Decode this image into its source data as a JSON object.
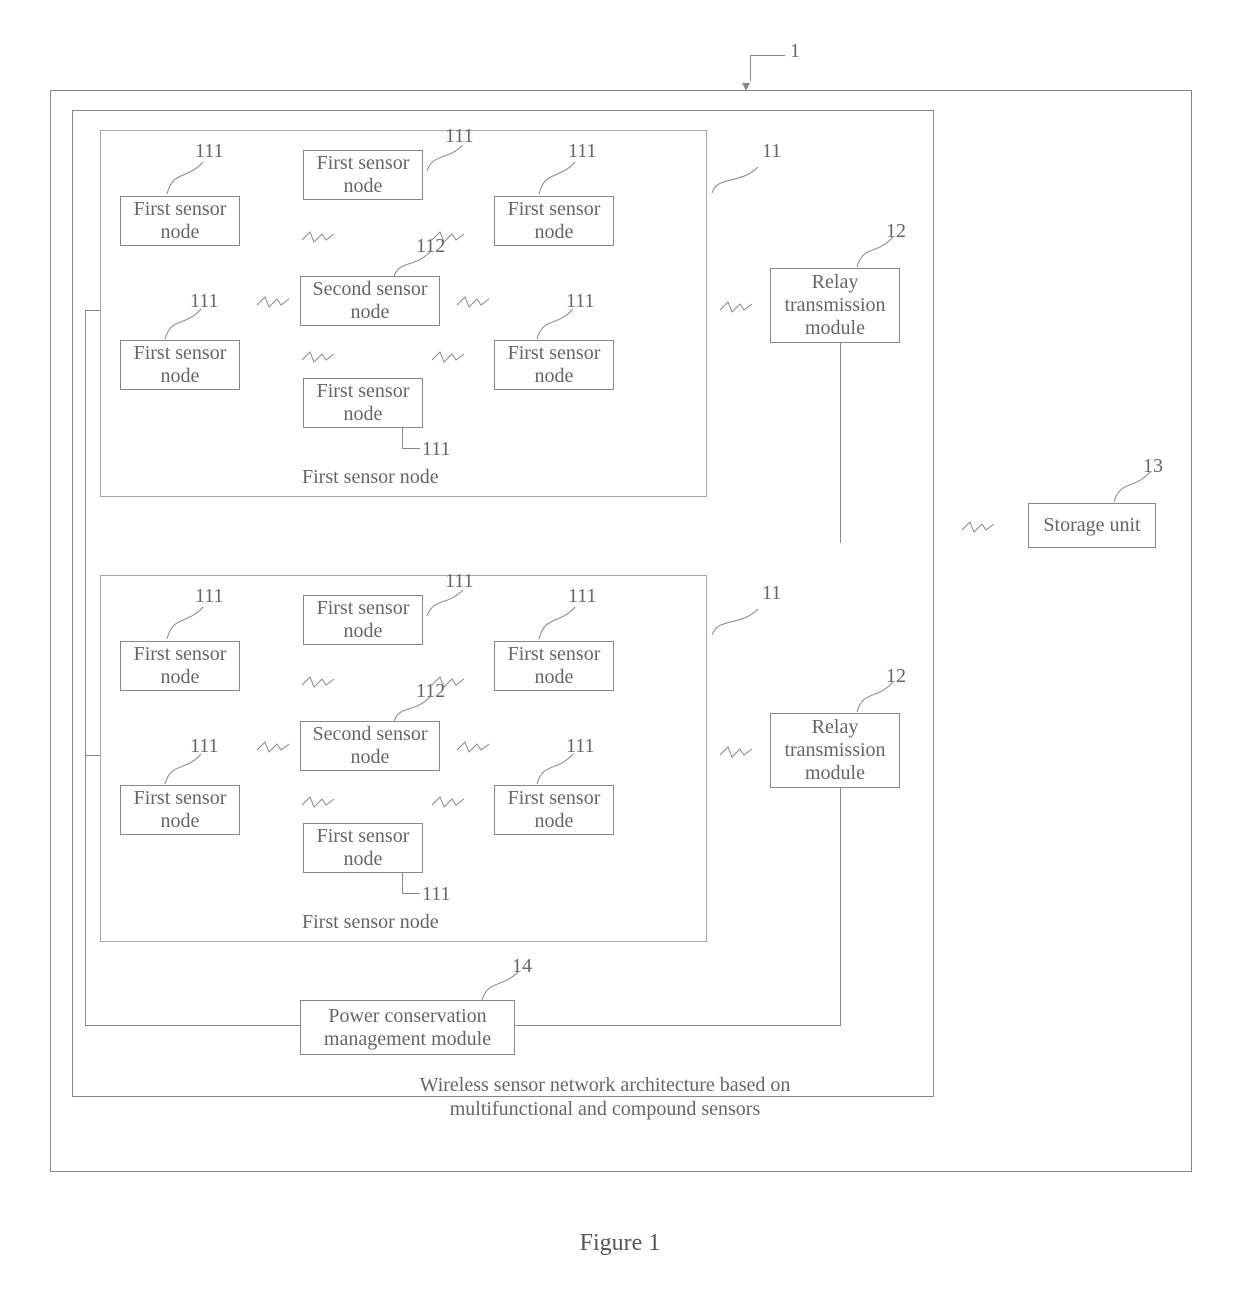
{
  "refs": {
    "system": "1",
    "cluster": "11",
    "first_sensor": "111",
    "second_sensor": "112",
    "relay": "12",
    "storage": "13",
    "power": "14"
  },
  "boxes": {
    "first_sensor": "First sensor\nnode",
    "second_sensor": "Second sensor\nnode",
    "relay": "Relay\ntransmission\nmodule",
    "storage": "Storage unit",
    "power": "Power conservation\nmanagement module"
  },
  "labels": {
    "cluster_caption": "First sensor node",
    "system_caption_line1": "Wireless sensor network architecture based on",
    "system_caption_line2": "multifunctional and compound sensors",
    "figure_caption": "Figure 1"
  }
}
